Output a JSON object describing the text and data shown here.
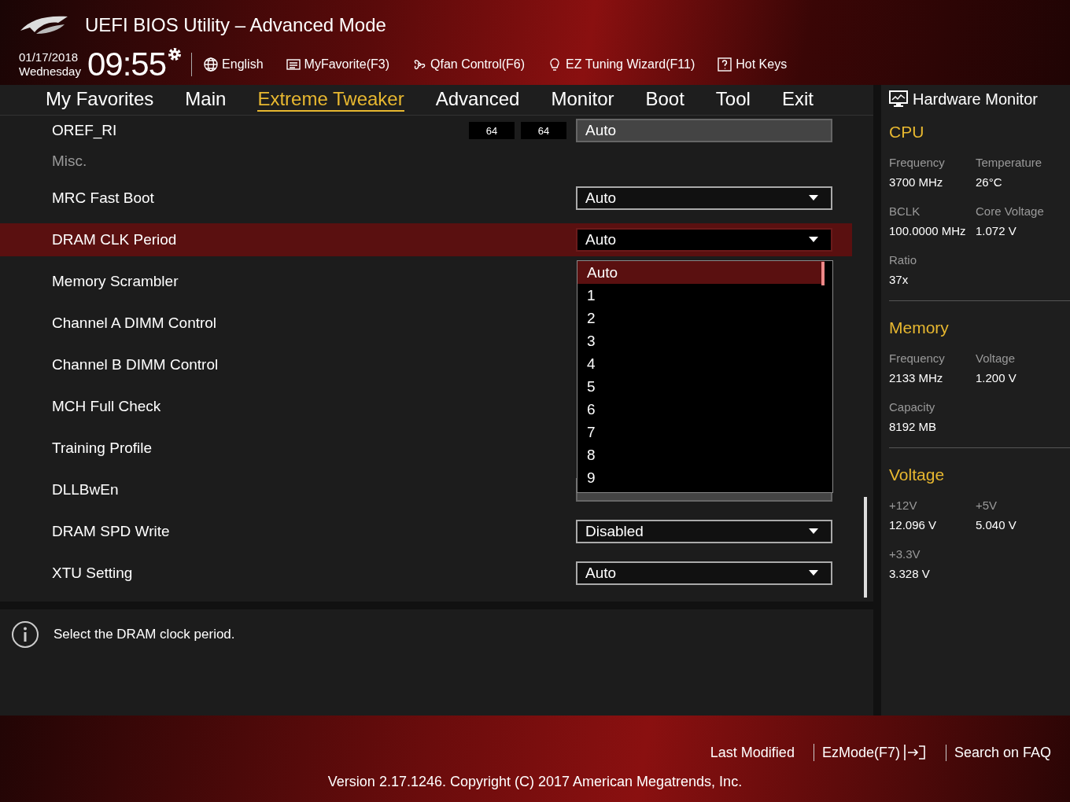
{
  "header": {
    "title": "UEFI BIOS Utility – Advanced Mode",
    "date": "01/17/2018",
    "weekday": "Wednesday",
    "time": "09:55",
    "tools": [
      {
        "label": "English"
      },
      {
        "label": "MyFavorite(F3)"
      },
      {
        "label": "Qfan Control(F6)"
      },
      {
        "label": "EZ Tuning Wizard(F11)"
      },
      {
        "label": "Hot Keys"
      }
    ]
  },
  "tabs": [
    {
      "label": "My Favorites",
      "selected": false
    },
    {
      "label": "Main",
      "selected": false
    },
    {
      "label": "Extreme Tweaker",
      "selected": true
    },
    {
      "label": "Advanced",
      "selected": false
    },
    {
      "label": "Monitor",
      "selected": false
    },
    {
      "label": "Boot",
      "selected": false
    },
    {
      "label": "Tool",
      "selected": false
    },
    {
      "label": "Exit",
      "selected": false
    }
  ],
  "settings": [
    {
      "kind": "channel-row",
      "label": "OREF_RI",
      "channels": [
        "64",
        "64"
      ],
      "value": "Auto",
      "selected": false
    },
    {
      "kind": "section",
      "label": "Misc."
    },
    {
      "kind": "dropdown",
      "label": "MRC Fast Boot",
      "value": "Auto",
      "selected": false
    },
    {
      "kind": "dropdown",
      "label": "DRAM CLK Period",
      "value": "Auto",
      "selected": true,
      "expanded": true
    },
    {
      "kind": "label",
      "label": "Memory Scrambler",
      "selected": false
    },
    {
      "kind": "label",
      "label": "Channel A DIMM Control",
      "selected": false
    },
    {
      "kind": "label",
      "label": "Channel B DIMM Control",
      "selected": false
    },
    {
      "kind": "label",
      "label": "MCH Full Check",
      "selected": false
    },
    {
      "kind": "label",
      "label": "Training Profile",
      "selected": false
    },
    {
      "kind": "covered-field",
      "label": "DLLBwEn",
      "selected": false
    },
    {
      "kind": "dropdown",
      "label": "DRAM SPD Write",
      "value": "Disabled",
      "selected": false
    },
    {
      "kind": "dropdown",
      "label": "XTU Setting",
      "value": "Auto",
      "selected": false
    }
  ],
  "options": [
    {
      "label": "Auto",
      "selected": true
    },
    {
      "label": "1",
      "selected": false
    },
    {
      "label": "2",
      "selected": false
    },
    {
      "label": "3",
      "selected": false
    },
    {
      "label": "4",
      "selected": false
    },
    {
      "label": "5",
      "selected": false
    },
    {
      "label": "6",
      "selected": false
    },
    {
      "label": "7",
      "selected": false
    },
    {
      "label": "8",
      "selected": false
    },
    {
      "label": "9",
      "selected": false
    }
  ],
  "help": "Select the DRAM clock period.",
  "monitor": {
    "title": "Hardware Monitor",
    "sections": [
      {
        "title": "CPU",
        "items": [
          {
            "label": "Frequency",
            "value": "3700 MHz"
          },
          {
            "label": "Temperature",
            "value": "26°C"
          },
          {
            "label": "BCLK",
            "value": "100.0000 MHz"
          },
          {
            "label": "Core Voltage",
            "value": "1.072 V"
          },
          {
            "label": "Ratio",
            "value": "37x"
          }
        ]
      },
      {
        "title": "Memory",
        "items": [
          {
            "label": "Frequency",
            "value": "2133 MHz"
          },
          {
            "label": "Voltage",
            "value": "1.200 V"
          },
          {
            "label": "Capacity",
            "value": "8192 MB"
          }
        ]
      },
      {
        "title": "Voltage",
        "items": [
          {
            "label": "+12V",
            "value": "12.096 V"
          },
          {
            "label": "+5V",
            "value": "5.040 V"
          },
          {
            "label": "+3.3V",
            "value": "3.328 V"
          }
        ]
      }
    ]
  },
  "footer": {
    "links": [
      {
        "label": "Last Modified"
      },
      {
        "label": "EzMode(F7)"
      },
      {
        "label": "Search on FAQ"
      }
    ],
    "version": "Version 2.17.1246. Copyright (C) 2017 American Megatrends, Inc."
  }
}
